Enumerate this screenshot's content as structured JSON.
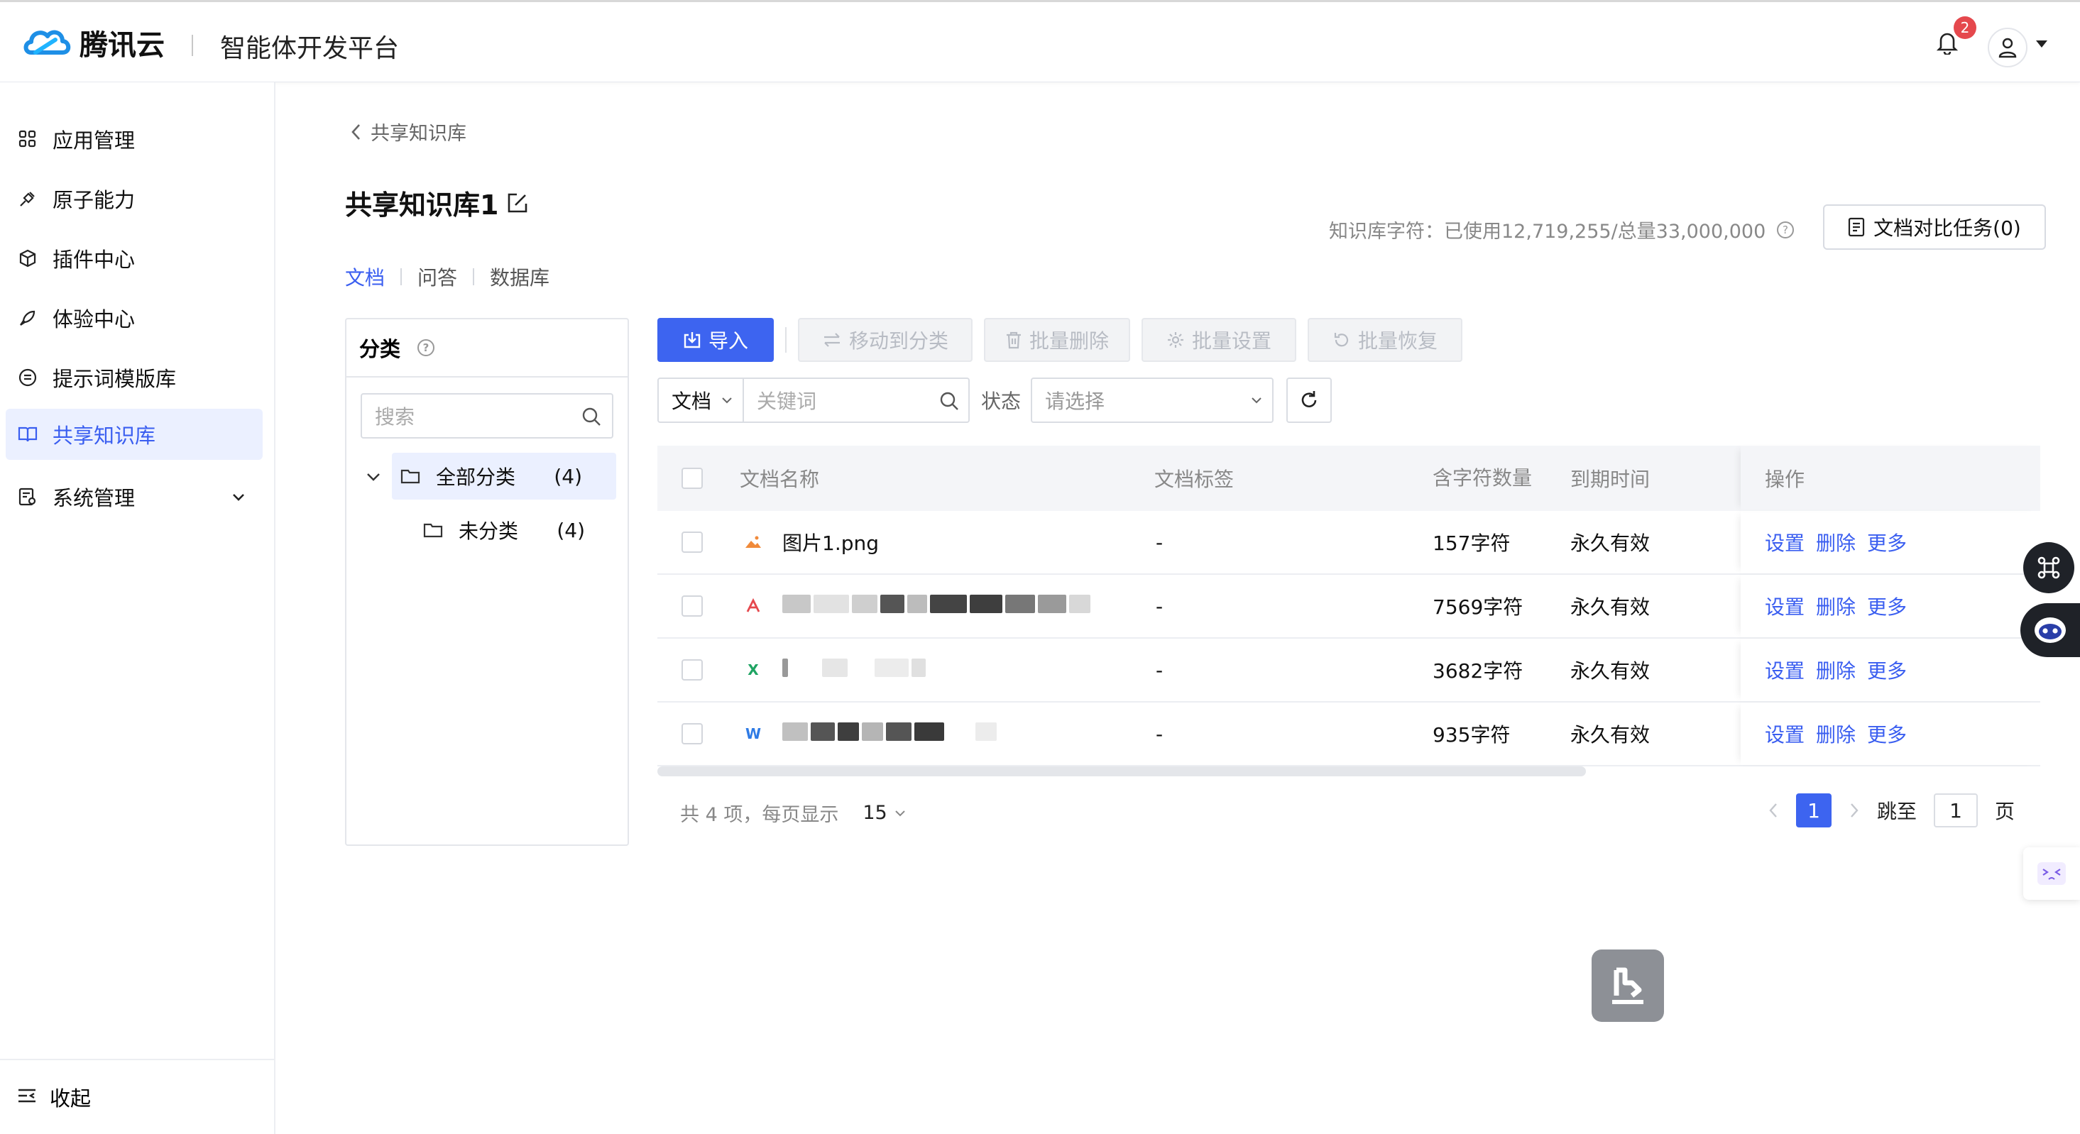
{
  "header": {
    "brand": "腾讯云",
    "platform_title": "智能体开发平台",
    "notification_count": "2"
  },
  "sidebar": {
    "items": [
      {
        "label": "应用管理"
      },
      {
        "label": "原子能力"
      },
      {
        "label": "插件中心"
      },
      {
        "label": "体验中心"
      },
      {
        "label": "提示词模版库"
      },
      {
        "label": "共享知识库"
      },
      {
        "label": "系统管理"
      }
    ],
    "collapse_label": "收起"
  },
  "breadcrumb": "共享知识库",
  "page_title": "共享知识库1",
  "quota_text": "知识库字符：已使用12,719,255/总量33,000,000",
  "compare_button": "文档对比任务(0)",
  "tabs": [
    "文档",
    "问答",
    "数据库"
  ],
  "category": {
    "title": "分类",
    "search_placeholder": "搜索",
    "all_label": "全部分类",
    "all_count": "(4)",
    "uncat_label": "未分类",
    "uncat_count": "(4)"
  },
  "toolbar": {
    "import": "导入",
    "move": "移动到分类",
    "batch_delete": "批量删除",
    "batch_settings": "批量设置",
    "batch_restore": "批量恢复"
  },
  "filter": {
    "type_value": "文档",
    "keyword_placeholder": "关键词",
    "status_label": "状态",
    "status_placeholder": "请选择"
  },
  "table": {
    "headers": {
      "name": "文档名称",
      "tag": "文档标签",
      "chars": "含字符数量",
      "expiry": "到期时间",
      "ops": "操作"
    },
    "rows": [
      {
        "name": "图片1.png",
        "icon": "image-file-icon",
        "tag": "-",
        "chars": "157字符",
        "expiry": "永久有效"
      },
      {
        "name": "",
        "icon": "pdf-file-icon",
        "tag": "-",
        "chars": "7569字符",
        "expiry": "永久有效"
      },
      {
        "name": "",
        "icon": "excel-file-icon",
        "tag": "-",
        "chars": "3682字符",
        "expiry": "永久有效"
      },
      {
        "name": "",
        "icon": "word-file-icon",
        "tag": "-",
        "chars": "935字符",
        "expiry": "永久有效"
      }
    ],
    "ops": {
      "settings": "设置",
      "delete": "删除",
      "more": "更多"
    }
  },
  "pagination": {
    "total_text": "共 4 项，每页显示",
    "page_size": "15",
    "current_page": "1",
    "jump_label": "跳至",
    "jump_value": "1",
    "page_suffix": "页"
  },
  "colors": {
    "accent": "#3d64f0",
    "active_bg": "#ebf0ff"
  }
}
